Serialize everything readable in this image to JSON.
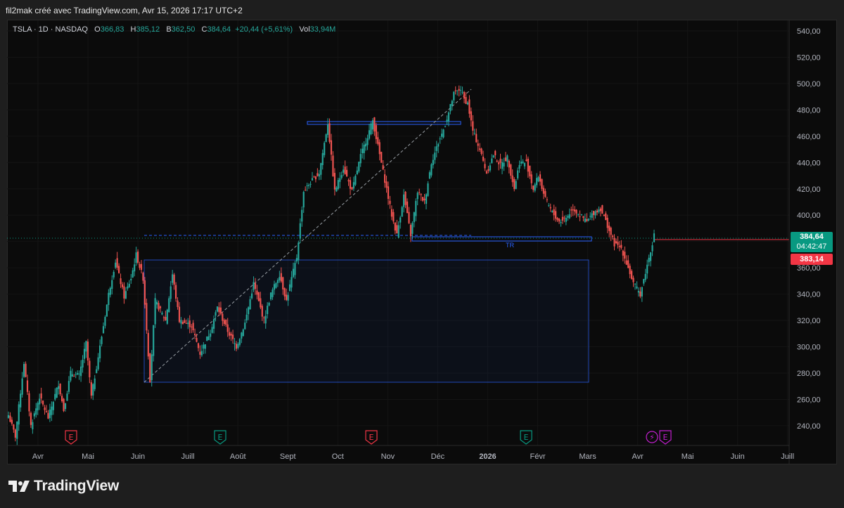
{
  "header": {
    "author_line": "fil2mak créé avec TradingView.com, Avr 15, 2026 17:17 UTC+2"
  },
  "legend": {
    "symbol": "TSLA · 1D · NASDAQ",
    "o_label": "O",
    "o": "366,83",
    "h_label": "H",
    "h": "385,12",
    "b_label": "B",
    "b": "362,50",
    "c_label": "C",
    "c": "384,64",
    "change": "+20,44 (+5,61%)",
    "vol_label": "Vol",
    "vol": "33,94M"
  },
  "price_tags": {
    "last": "384,64",
    "countdown": "04:42:47",
    "prev": "383,14",
    "last_color": "#089981",
    "prev_color": "#f23645"
  },
  "annotations": {
    "tr_label": "TR"
  },
  "earnings_markers": [
    {
      "label": "E",
      "color": "#f23645"
    },
    {
      "label": "E",
      "color": "#089981"
    },
    {
      "label": "E",
      "color": "#f23645"
    },
    {
      "label": "E",
      "color": "#089981"
    },
    {
      "label": "⚡",
      "color": "#c21fcf"
    },
    {
      "label": "E",
      "color": "#c21fcf"
    }
  ],
  "branding": {
    "logo_text": "TradingView",
    "logo_icon": "tradingview-logo-icon"
  },
  "chart_data": {
    "type": "candlestick",
    "symbol": "TSLA",
    "interval": "1D",
    "exchange": "NASDAQ",
    "ylim": [
      225,
      548
    ],
    "y_ticks": [
      "240,00",
      "260,00",
      "280,00",
      "300,00",
      "320,00",
      "340,00",
      "360,00",
      "380,00",
      "400,00",
      "420,00",
      "440,00",
      "460,00",
      "480,00",
      "500,00",
      "520,00",
      "540,00"
    ],
    "x_ticks": [
      "Avr",
      "Mai",
      "Juin",
      "Juill",
      "Août",
      "Sept",
      "Oct",
      "Nov",
      "Déc",
      "2026",
      "Févr",
      "Mars",
      "Avr",
      "Mai",
      "Juin",
      "Juill"
    ],
    "colors": {
      "up": "#26a69a",
      "down": "#ef5350",
      "zone": "#2962ff"
    },
    "series_path": [
      [
        0,
        248
      ],
      [
        4,
        232
      ],
      [
        9,
        288
      ],
      [
        13,
        240
      ],
      [
        18,
        262
      ],
      [
        23,
        246
      ],
      [
        29,
        272
      ],
      [
        32,
        252
      ],
      [
        36,
        280
      ],
      [
        41,
        278
      ],
      [
        45,
        303
      ],
      [
        48,
        262
      ],
      [
        53,
        300
      ],
      [
        58,
        340
      ],
      [
        62,
        365
      ],
      [
        67,
        338
      ],
      [
        71,
        352
      ],
      [
        74,
        370
      ],
      [
        78,
        352
      ],
      [
        82,
        275
      ],
      [
        85,
        335
      ],
      [
        91,
        320
      ],
      [
        95,
        355
      ],
      [
        99,
        320
      ],
      [
        106,
        316
      ],
      [
        111,
        295
      ],
      [
        117,
        312
      ],
      [
        121,
        330
      ],
      [
        127,
        312
      ],
      [
        132,
        300
      ],
      [
        137,
        318
      ],
      [
        142,
        348
      ],
      [
        148,
        320
      ],
      [
        152,
        340
      ],
      [
        157,
        355
      ],
      [
        161,
        335
      ],
      [
        164,
        352
      ],
      [
        167,
        368
      ],
      [
        171,
        418
      ],
      [
        175,
        425
      ],
      [
        180,
        432
      ],
      [
        185,
        470
      ],
      [
        189,
        418
      ],
      [
        194,
        436
      ],
      [
        199,
        418
      ],
      [
        204,
        445
      ],
      [
        208,
        460
      ],
      [
        211,
        472
      ],
      [
        215,
        446
      ],
      [
        219,
        420
      ],
      [
        222,
        400
      ],
      [
        225,
        385
      ],
      [
        229,
        415
      ],
      [
        233,
        385
      ],
      [
        237,
        418
      ],
      [
        241,
        410
      ],
      [
        245,
        440
      ],
      [
        249,
        455
      ],
      [
        252,
        465
      ],
      [
        255,
        478
      ],
      [
        258,
        492
      ],
      [
        262,
        496
      ],
      [
        264,
        488
      ],
      [
        266,
        485
      ],
      [
        269,
        464
      ],
      [
        273,
        450
      ],
      [
        277,
        432
      ],
      [
        281,
        446
      ],
      [
        285,
        438
      ],
      [
        289,
        444
      ],
      [
        293,
        420
      ],
      [
        296,
        440
      ],
      [
        300,
        440
      ],
      [
        304,
        420
      ],
      [
        307,
        430
      ],
      [
        311,
        412
      ],
      [
        315,
        402
      ],
      [
        319,
        395
      ],
      [
        323,
        398
      ],
      [
        327,
        405
      ],
      [
        331,
        400
      ],
      [
        335,
        395
      ],
      [
        339,
        402
      ],
      [
        343,
        405
      ],
      [
        347,
        392
      ],
      [
        351,
        378
      ],
      [
        355,
        375
      ],
      [
        359,
        360
      ],
      [
        362,
        348
      ],
      [
        366,
        340
      ],
      [
        370,
        362
      ],
      [
        374,
        384.64
      ]
    ]
  }
}
